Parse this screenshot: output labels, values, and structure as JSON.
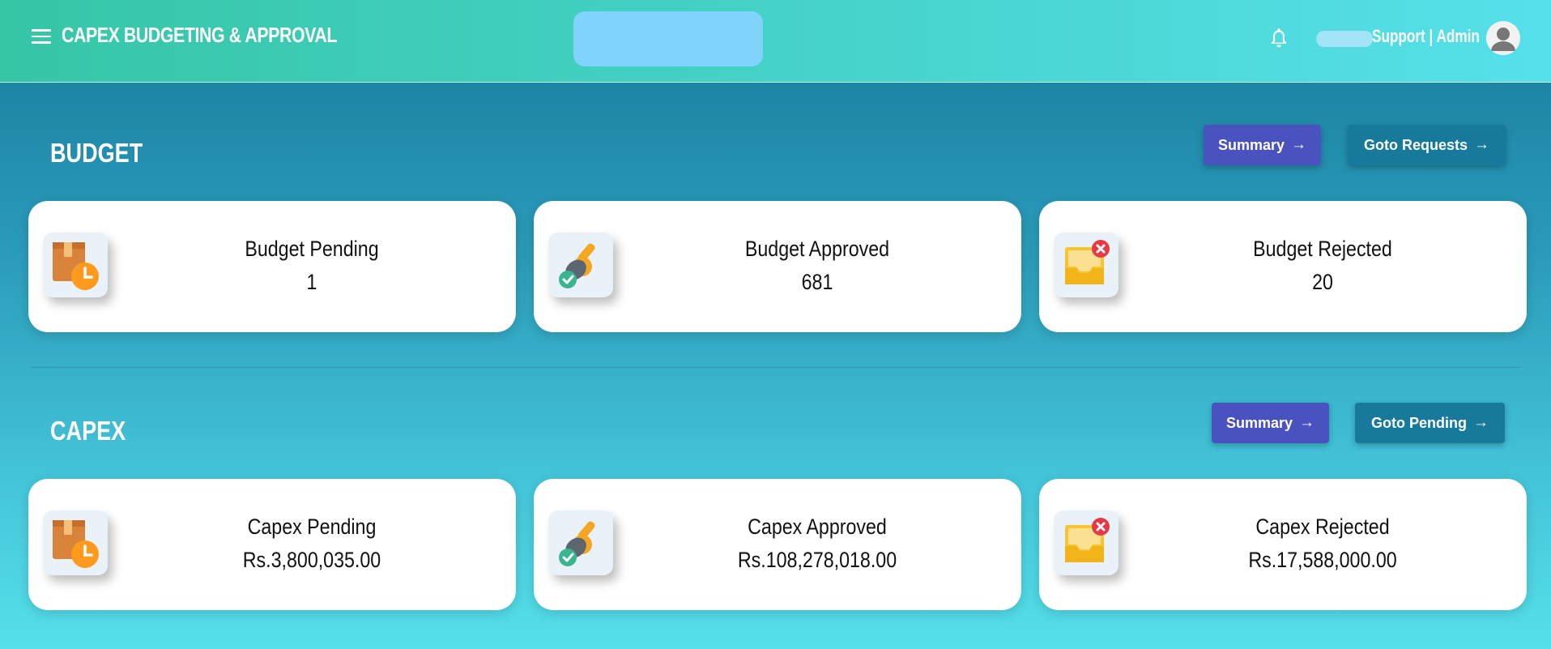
{
  "header": {
    "title": "CAPEX BUDGETING & APPROVAL",
    "user_label": "Support | Admin"
  },
  "budget": {
    "title": "BUDGET",
    "summary_label": "Summary",
    "goto_label": "Goto Requests",
    "cards": [
      {
        "label": "Budget Pending",
        "value": "1",
        "icon": "box-clock-icon"
      },
      {
        "label": "Budget Approved",
        "value": "681",
        "icon": "approval-stamp-icon"
      },
      {
        "label": "Budget Rejected",
        "value": "20",
        "icon": "rejected-inbox-icon"
      }
    ]
  },
  "capex": {
    "title": "CAPEX",
    "summary_label": "Summary",
    "goto_label": "Goto Pending",
    "cards": [
      {
        "label": "Capex Pending",
        "value": "Rs.3,800,035.00",
        "icon": "box-clock-icon"
      },
      {
        "label": "Capex Approved",
        "value": "Rs.108,278,018.00",
        "icon": "approval-stamp-icon"
      },
      {
        "label": "Capex Rejected",
        "value": "Rs.17,588,000.00",
        "icon": "rejected-inbox-icon"
      }
    ]
  },
  "colors": {
    "primary_button": "#4a52c0",
    "secondary_button": "#177a9a",
    "header_gradient_start": "#36c6a6",
    "header_gradient_end": "#56e0ea"
  }
}
